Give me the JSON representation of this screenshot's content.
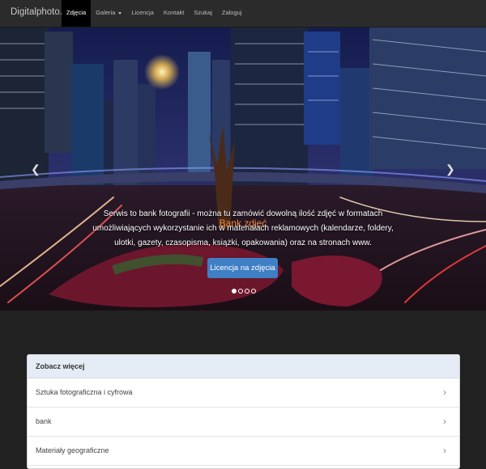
{
  "navbar": {
    "brand": "Digitalphoto.pl",
    "items": [
      {
        "label": "Zdjęcia"
      },
      {
        "label": "Galeria"
      },
      {
        "label": "Licencja"
      },
      {
        "label": "Kontakt"
      },
      {
        "label": "Szukaj"
      },
      {
        "label": "Zaloguj"
      }
    ]
  },
  "hero": {
    "title": "Bank zdjęć",
    "text": "Serwis to bank fotografii - można tu zamówić dowolną ilość zdjęć w formatach umożliwiających wykorzystanie ich w materiałach reklamowych (kalendarze, foldery, ulotki, gazety, czasopisma, książki, opakowania) oraz na stronach www.",
    "button": "Licencja na zdjęcia",
    "prev_icon": "chevron-left",
    "next_icon": "chevron-right",
    "slides": 4,
    "active_slide": 1
  },
  "sidebar_panel": {
    "heading": "Zobacz więcej",
    "items": [
      {
        "label": "Sztuka fotograficzna i cyfrowa"
      },
      {
        "label": "bank"
      },
      {
        "label": "Materiały geograficzne"
      }
    ]
  },
  "colors": {
    "navbar_bg": "#2b2b2b",
    "page_bg": "#212121",
    "hero_title": "#f0883c",
    "button_bg": "#3f7fc4",
    "panel_heading_bg": "#e6ecf6"
  }
}
